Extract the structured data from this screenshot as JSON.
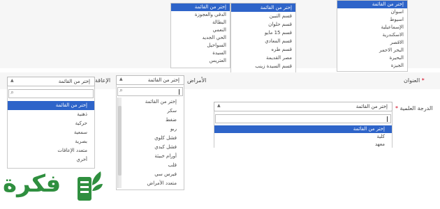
{
  "top_lists": {
    "list1": {
      "items": [
        "إختر من القائمة",
        "الدقي والعجوزة",
        "البطالة",
        "النعمي",
        "الحي الجديد",
        "السواحيل",
        "السيدة",
        "العتريس"
      ],
      "selected_index": 0
    },
    "list2": {
      "items": [
        "إختر من القائمة",
        "قسم التبين",
        "قسم حلوان",
        "قسم 15 مايو",
        "قسم المعادي",
        "قسم طره",
        "مصر القديمة",
        "قسم السيدة زينب"
      ],
      "selected_index": 0
    },
    "list3": {
      "items": [
        "إختر من القائمة",
        "اسوان",
        "اسيوط",
        "الإسماعيلية",
        "الاسكندرية",
        "الاقصر",
        "البحر الاحمر",
        "البحيرة",
        "الجيزة"
      ],
      "selected_index": 0
    }
  },
  "labels": {
    "address": "العنوان",
    "disease": "الأمراض",
    "disability": "الإعاقة",
    "degree": "الدرجة العلمية",
    "required": "*"
  },
  "disability_select": {
    "value": "إختر من القائمة",
    "options": [
      "إختر من القائمة",
      "ذهنية",
      "حركية",
      "سمعية",
      "بصرية",
      "متعدد الإعاقات",
      "أخري"
    ],
    "selected_index": 0
  },
  "disease_select": {
    "value": "إختر من القائمة",
    "options": [
      "إختر من القائمة",
      "سكر",
      "ضغط",
      "ربو",
      "فشل كلوي",
      "فشل كبدي",
      "أورام خبيثة",
      "قلب",
      "فيرس سي",
      "متعدد الأمراض"
    ]
  },
  "degree_select": {
    "value": "إختر من القائمة",
    "options": [
      "إختر من القائمة",
      "كلية",
      "معهد"
    ],
    "selected_index": 0
  },
  "logo": {
    "text": "فكرة"
  },
  "colors": {
    "selected": "#2e64c9",
    "logo_green": "#2f8f3f",
    "required": "#d0021b"
  }
}
